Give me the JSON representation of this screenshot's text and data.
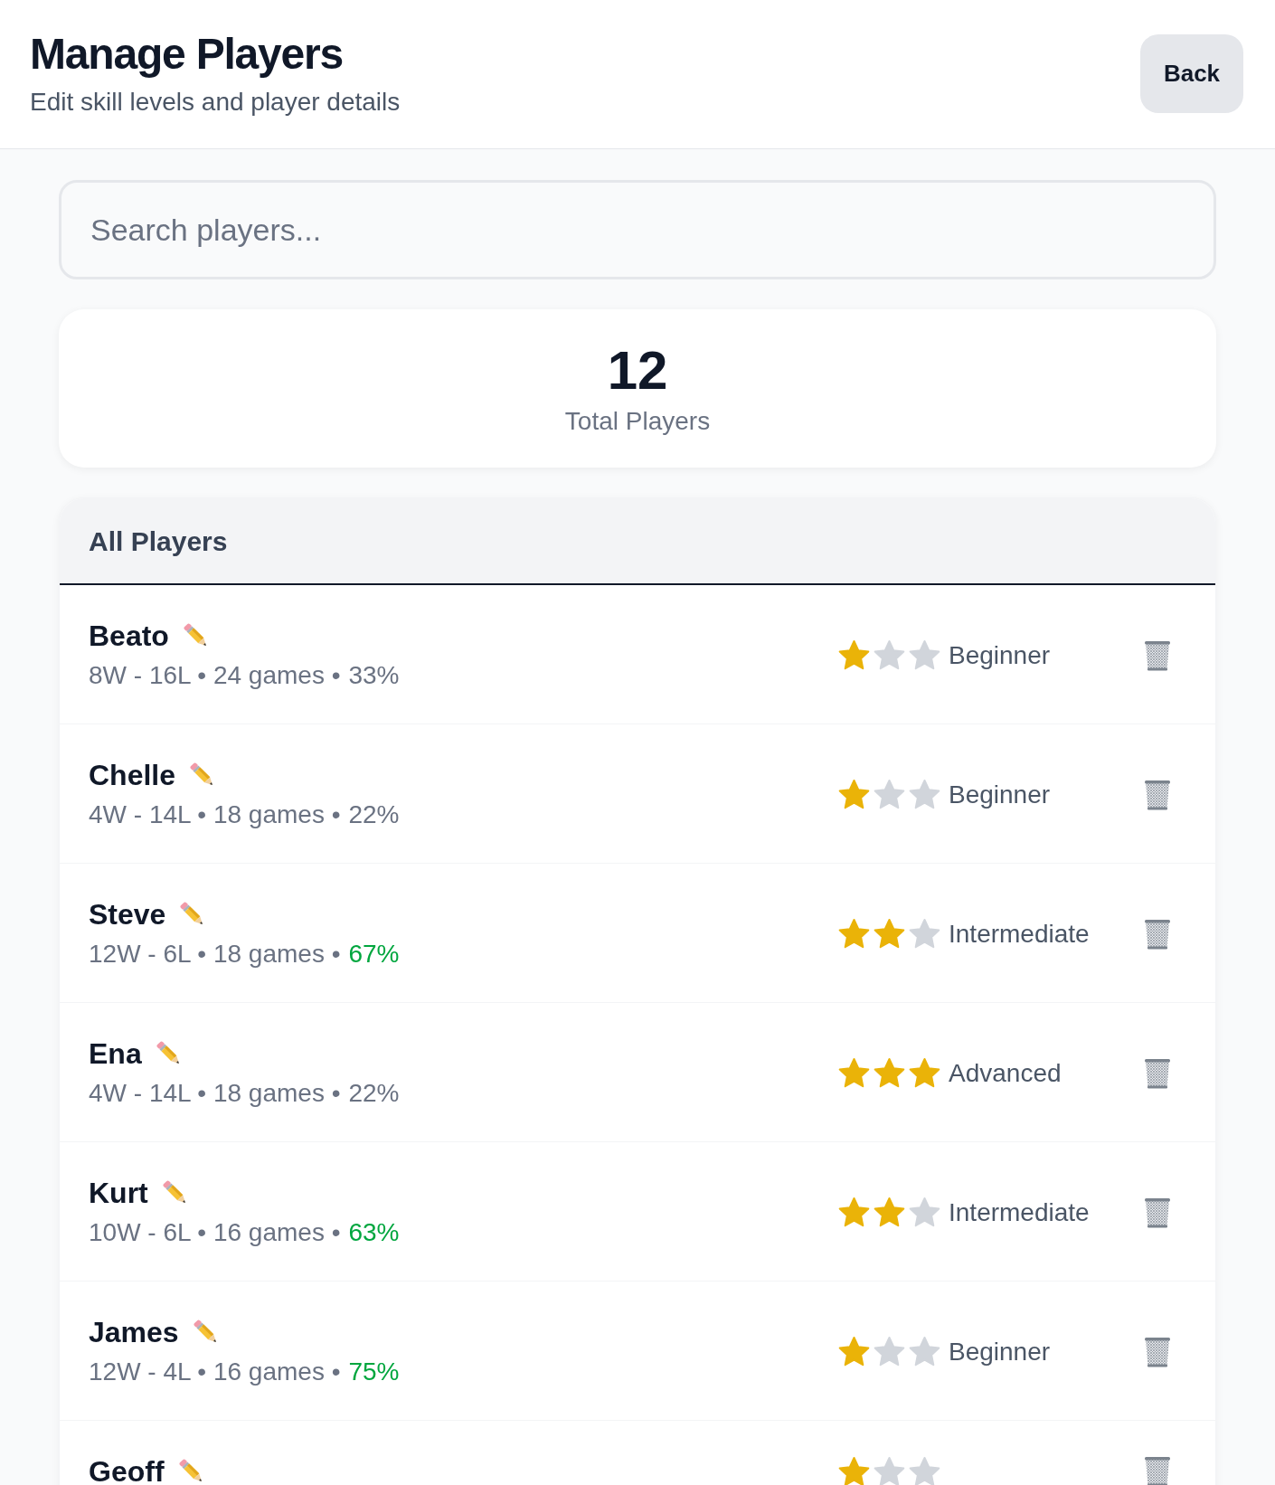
{
  "header": {
    "title": "Manage Players",
    "subtitle": "Edit skill levels and player details",
    "back_button": "Back"
  },
  "search": {
    "placeholder": "Search players..."
  },
  "summary": {
    "count": "12",
    "label": "Total Players"
  },
  "player_list": {
    "title": "All Players",
    "players": [
      {
        "name": "Beato",
        "stats": "8W - 16L • 24 games •",
        "win_rate": "33%",
        "win_rate_good": false,
        "stars": 1,
        "level": "Beginner"
      },
      {
        "name": "Chelle",
        "stats": "4W - 14L • 18 games •",
        "win_rate": "22%",
        "win_rate_good": false,
        "stars": 1,
        "level": "Beginner"
      },
      {
        "name": "Steve",
        "stats": "12W - 6L • 18 games •",
        "win_rate": "67%",
        "win_rate_good": true,
        "stars": 2,
        "level": "Intermediate"
      },
      {
        "name": "Ena",
        "stats": "4W - 14L • 18 games •",
        "win_rate": "22%",
        "win_rate_good": false,
        "stars": 3,
        "level": "Advanced"
      },
      {
        "name": "Kurt",
        "stats": "10W - 6L • 16 games •",
        "win_rate": "63%",
        "win_rate_good": true,
        "stars": 2,
        "level": "Intermediate"
      },
      {
        "name": "James",
        "stats": "12W - 4L • 16 games •",
        "win_rate": "75%",
        "win_rate_good": true,
        "stars": 1,
        "level": "Beginner"
      },
      {
        "name": "Geoff",
        "stars": 1
      }
    ]
  }
}
